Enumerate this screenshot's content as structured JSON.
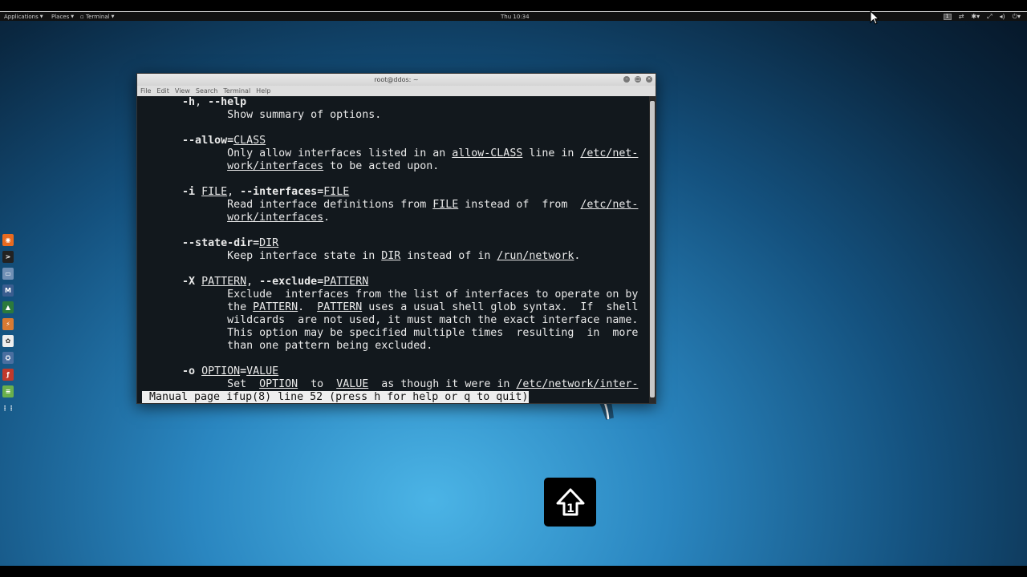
{
  "topbar": {
    "applications": "Applications",
    "places": "Places",
    "terminal": "Terminal",
    "clock": "Thu 10:34",
    "workspace": "1"
  },
  "dock": [
    {
      "name": "firefox-icon",
      "color": "#e86a1f",
      "glyph": "◉"
    },
    {
      "name": "terminal-icon",
      "color": "#222222",
      "glyph": ">"
    },
    {
      "name": "files-icon",
      "color": "#6f8fb5",
      "glyph": "▭"
    },
    {
      "name": "metasploit-icon",
      "color": "#3a5d8f",
      "glyph": "M"
    },
    {
      "name": "armitage-icon",
      "color": "#2b7a3c",
      "glyph": "▲"
    },
    {
      "name": "burpsuite-icon",
      "color": "#d87a32",
      "glyph": "⚡"
    },
    {
      "name": "faraday-icon",
      "color": "#eeeeee",
      "glyph": "✿"
    },
    {
      "name": "maltego-icon",
      "color": "#4a6fa0",
      "glyph": "⛭"
    },
    {
      "name": "beef-icon",
      "color": "#c0392b",
      "glyph": "ƒ"
    },
    {
      "name": "leafpad-icon",
      "color": "#6ab04c",
      "glyph": "≡"
    },
    {
      "name": "show-apps-icon",
      "color": "transparent",
      "glyph": "⋮⋮"
    }
  ],
  "terminal": {
    "title": "root@ddos: ~",
    "menu": [
      "File",
      "Edit",
      "View",
      "Search",
      "Terminal",
      "Help"
    ],
    "lines": [
      [
        [
          "       ",
          ""
        ],
        [
          "-h",
          "b"
        ],
        [
          ", ",
          ""
        ],
        [
          "--help",
          "b"
        ]
      ],
      [
        [
          "              Show summary of options.",
          ""
        ]
      ],
      [],
      [
        [
          "       ",
          ""
        ],
        [
          "--allow=",
          "b"
        ],
        [
          "CLASS",
          "u"
        ]
      ],
      [
        [
          "              Only allow interfaces listed in an ",
          ""
        ],
        [
          "allow-CLASS",
          "u"
        ],
        [
          " line in ",
          ""
        ],
        [
          "/etc/net-",
          "u"
        ]
      ],
      [
        [
          "              ",
          ""
        ],
        [
          "work/interfaces",
          "u"
        ],
        [
          " to be acted upon.",
          ""
        ]
      ],
      [],
      [
        [
          "       ",
          ""
        ],
        [
          "-i",
          "b"
        ],
        [
          " ",
          ""
        ],
        [
          "FILE",
          "u"
        ],
        [
          ", ",
          ""
        ],
        [
          "--interfaces=",
          "b"
        ],
        [
          "FILE",
          "u"
        ]
      ],
      [
        [
          "              Read interface definitions from ",
          ""
        ],
        [
          "FILE",
          "u"
        ],
        [
          " instead of  from  ",
          ""
        ],
        [
          "/etc/net-",
          "u"
        ]
      ],
      [
        [
          "              ",
          ""
        ],
        [
          "work/interfaces",
          "u"
        ],
        [
          ".",
          ""
        ]
      ],
      [],
      [
        [
          "       ",
          ""
        ],
        [
          "--state-dir=",
          "b"
        ],
        [
          "DIR",
          "u"
        ]
      ],
      [
        [
          "              Keep interface state in ",
          ""
        ],
        [
          "DIR",
          "u"
        ],
        [
          " instead of in ",
          ""
        ],
        [
          "/run/network",
          "u"
        ],
        [
          ".",
          ""
        ]
      ],
      [],
      [
        [
          "       ",
          ""
        ],
        [
          "-X",
          "b"
        ],
        [
          " ",
          ""
        ],
        [
          "PATTERN",
          "u"
        ],
        [
          ", ",
          ""
        ],
        [
          "--exclude=",
          "b"
        ],
        [
          "PATTERN",
          "u"
        ]
      ],
      [
        [
          "              Exclude  interfaces from the list of interfaces to operate on by",
          ""
        ]
      ],
      [
        [
          "              the ",
          ""
        ],
        [
          "PATTERN",
          "u"
        ],
        [
          ".  ",
          ""
        ],
        [
          "PATTERN",
          "u"
        ],
        [
          " uses a usual shell glob syntax.  If  shell",
          ""
        ]
      ],
      [
        [
          "              wildcards  are not used, it must match the exact interface name.",
          ""
        ]
      ],
      [
        [
          "              This option may be specified multiple times  resulting  in  more",
          ""
        ]
      ],
      [
        [
          "              than one pattern being excluded.",
          ""
        ]
      ],
      [],
      [
        [
          "       ",
          ""
        ],
        [
          "-o",
          "b"
        ],
        [
          " ",
          ""
        ],
        [
          "OPTION",
          "u"
        ],
        [
          "=",
          "b"
        ],
        [
          "VALUE",
          "u"
        ]
      ],
      [
        [
          "              Set  ",
          ""
        ],
        [
          "OPTION",
          "u"
        ],
        [
          "  to  ",
          ""
        ],
        [
          "VALUE",
          "u"
        ],
        [
          "  as though it were in ",
          ""
        ],
        [
          "/etc/network/inter-",
          "u"
        ]
      ]
    ],
    "status": " Manual page ifup(8) line 52 (press h for help or q to quit)"
  }
}
